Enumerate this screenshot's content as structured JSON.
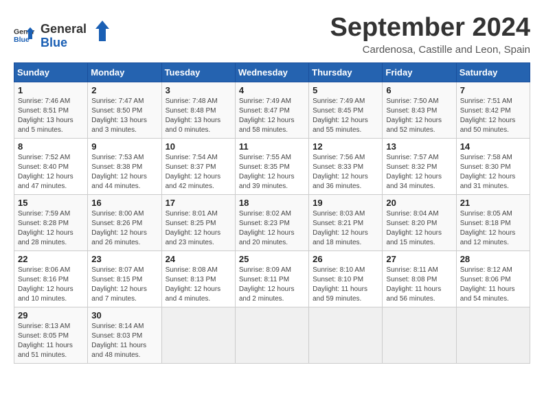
{
  "header": {
    "logo_line1": "General",
    "logo_line2": "Blue",
    "title": "September 2024",
    "subtitle": "Cardenosa, Castille and Leon, Spain"
  },
  "columns": [
    "Sunday",
    "Monday",
    "Tuesday",
    "Wednesday",
    "Thursday",
    "Friday",
    "Saturday"
  ],
  "weeks": [
    [
      {
        "day": "1",
        "info": "Sunrise: 7:46 AM\nSunset: 8:51 PM\nDaylight: 13 hours\nand 5 minutes."
      },
      {
        "day": "2",
        "info": "Sunrise: 7:47 AM\nSunset: 8:50 PM\nDaylight: 13 hours\nand 3 minutes."
      },
      {
        "day": "3",
        "info": "Sunrise: 7:48 AM\nSunset: 8:48 PM\nDaylight: 13 hours\nand 0 minutes."
      },
      {
        "day": "4",
        "info": "Sunrise: 7:49 AM\nSunset: 8:47 PM\nDaylight: 12 hours\nand 58 minutes."
      },
      {
        "day": "5",
        "info": "Sunrise: 7:49 AM\nSunset: 8:45 PM\nDaylight: 12 hours\nand 55 minutes."
      },
      {
        "day": "6",
        "info": "Sunrise: 7:50 AM\nSunset: 8:43 PM\nDaylight: 12 hours\nand 52 minutes."
      },
      {
        "day": "7",
        "info": "Sunrise: 7:51 AM\nSunset: 8:42 PM\nDaylight: 12 hours\nand 50 minutes."
      }
    ],
    [
      {
        "day": "8",
        "info": "Sunrise: 7:52 AM\nSunset: 8:40 PM\nDaylight: 12 hours\nand 47 minutes."
      },
      {
        "day": "9",
        "info": "Sunrise: 7:53 AM\nSunset: 8:38 PM\nDaylight: 12 hours\nand 44 minutes."
      },
      {
        "day": "10",
        "info": "Sunrise: 7:54 AM\nSunset: 8:37 PM\nDaylight: 12 hours\nand 42 minutes."
      },
      {
        "day": "11",
        "info": "Sunrise: 7:55 AM\nSunset: 8:35 PM\nDaylight: 12 hours\nand 39 minutes."
      },
      {
        "day": "12",
        "info": "Sunrise: 7:56 AM\nSunset: 8:33 PM\nDaylight: 12 hours\nand 36 minutes."
      },
      {
        "day": "13",
        "info": "Sunrise: 7:57 AM\nSunset: 8:32 PM\nDaylight: 12 hours\nand 34 minutes."
      },
      {
        "day": "14",
        "info": "Sunrise: 7:58 AM\nSunset: 8:30 PM\nDaylight: 12 hours\nand 31 minutes."
      }
    ],
    [
      {
        "day": "15",
        "info": "Sunrise: 7:59 AM\nSunset: 8:28 PM\nDaylight: 12 hours\nand 28 minutes."
      },
      {
        "day": "16",
        "info": "Sunrise: 8:00 AM\nSunset: 8:26 PM\nDaylight: 12 hours\nand 26 minutes."
      },
      {
        "day": "17",
        "info": "Sunrise: 8:01 AM\nSunset: 8:25 PM\nDaylight: 12 hours\nand 23 minutes."
      },
      {
        "day": "18",
        "info": "Sunrise: 8:02 AM\nSunset: 8:23 PM\nDaylight: 12 hours\nand 20 minutes."
      },
      {
        "day": "19",
        "info": "Sunrise: 8:03 AM\nSunset: 8:21 PM\nDaylight: 12 hours\nand 18 minutes."
      },
      {
        "day": "20",
        "info": "Sunrise: 8:04 AM\nSunset: 8:20 PM\nDaylight: 12 hours\nand 15 minutes."
      },
      {
        "day": "21",
        "info": "Sunrise: 8:05 AM\nSunset: 8:18 PM\nDaylight: 12 hours\nand 12 minutes."
      }
    ],
    [
      {
        "day": "22",
        "info": "Sunrise: 8:06 AM\nSunset: 8:16 PM\nDaylight: 12 hours\nand 10 minutes."
      },
      {
        "day": "23",
        "info": "Sunrise: 8:07 AM\nSunset: 8:15 PM\nDaylight: 12 hours\nand 7 minutes."
      },
      {
        "day": "24",
        "info": "Sunrise: 8:08 AM\nSunset: 8:13 PM\nDaylight: 12 hours\nand 4 minutes."
      },
      {
        "day": "25",
        "info": "Sunrise: 8:09 AM\nSunset: 8:11 PM\nDaylight: 12 hours\nand 2 minutes."
      },
      {
        "day": "26",
        "info": "Sunrise: 8:10 AM\nSunset: 8:10 PM\nDaylight: 11 hours\nand 59 minutes."
      },
      {
        "day": "27",
        "info": "Sunrise: 8:11 AM\nSunset: 8:08 PM\nDaylight: 11 hours\nand 56 minutes."
      },
      {
        "day": "28",
        "info": "Sunrise: 8:12 AM\nSunset: 8:06 PM\nDaylight: 11 hours\nand 54 minutes."
      }
    ],
    [
      {
        "day": "29",
        "info": "Sunrise: 8:13 AM\nSunset: 8:05 PM\nDaylight: 11 hours\nand 51 minutes."
      },
      {
        "day": "30",
        "info": "Sunrise: 8:14 AM\nSunset: 8:03 PM\nDaylight: 11 hours\nand 48 minutes."
      },
      null,
      null,
      null,
      null,
      null
    ]
  ]
}
